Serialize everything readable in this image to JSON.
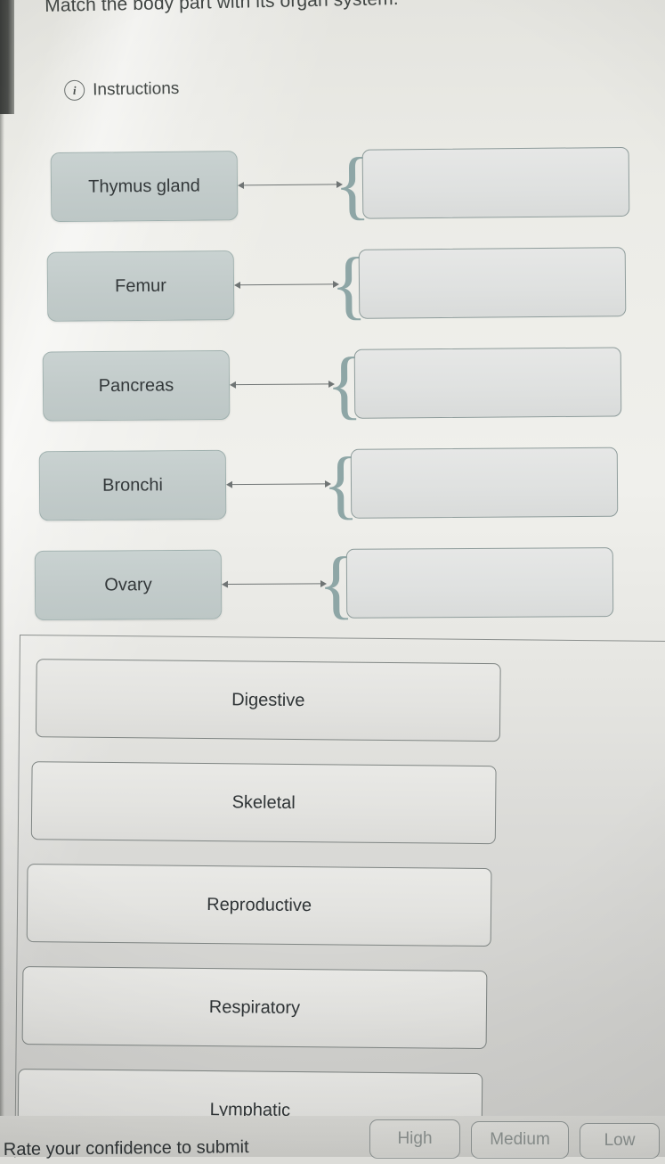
{
  "question": {
    "prompt": "Match the body part with its organ system."
  },
  "instructions": {
    "icon": "info-circle-icon",
    "label": "Instructions"
  },
  "matching": {
    "pairs": [
      {
        "term": "Thymus gland",
        "answer": ""
      },
      {
        "term": "Femur",
        "answer": ""
      },
      {
        "term": "Pancreas",
        "answer": ""
      },
      {
        "term": "Bronchi",
        "answer": ""
      },
      {
        "term": "Ovary",
        "answer": ""
      }
    ],
    "brace": "{",
    "connector": "double-headed-arrow"
  },
  "options": {
    "items": [
      {
        "label": "Digestive"
      },
      {
        "label": "Skeletal"
      },
      {
        "label": "Reproductive"
      },
      {
        "label": "Respiratory"
      },
      {
        "label": "Lymphatic"
      }
    ]
  },
  "confidence": {
    "prompt": "Rate your confidence to submit",
    "buttons": [
      {
        "label": "High"
      },
      {
        "label": "Medium"
      },
      {
        "label": "Low"
      }
    ]
  },
  "colors": {
    "term_fill": "#c3cccb",
    "term_border": "#9fb0ae",
    "drop_fill": "#e2e3e2",
    "drop_border": "#8d9b9a",
    "brace": "#8ea6a6",
    "option_fill": "#e4e4e1",
    "option_border": "#7f8583",
    "text": "#2f3436",
    "page_bg": "#e8e8e4"
  }
}
